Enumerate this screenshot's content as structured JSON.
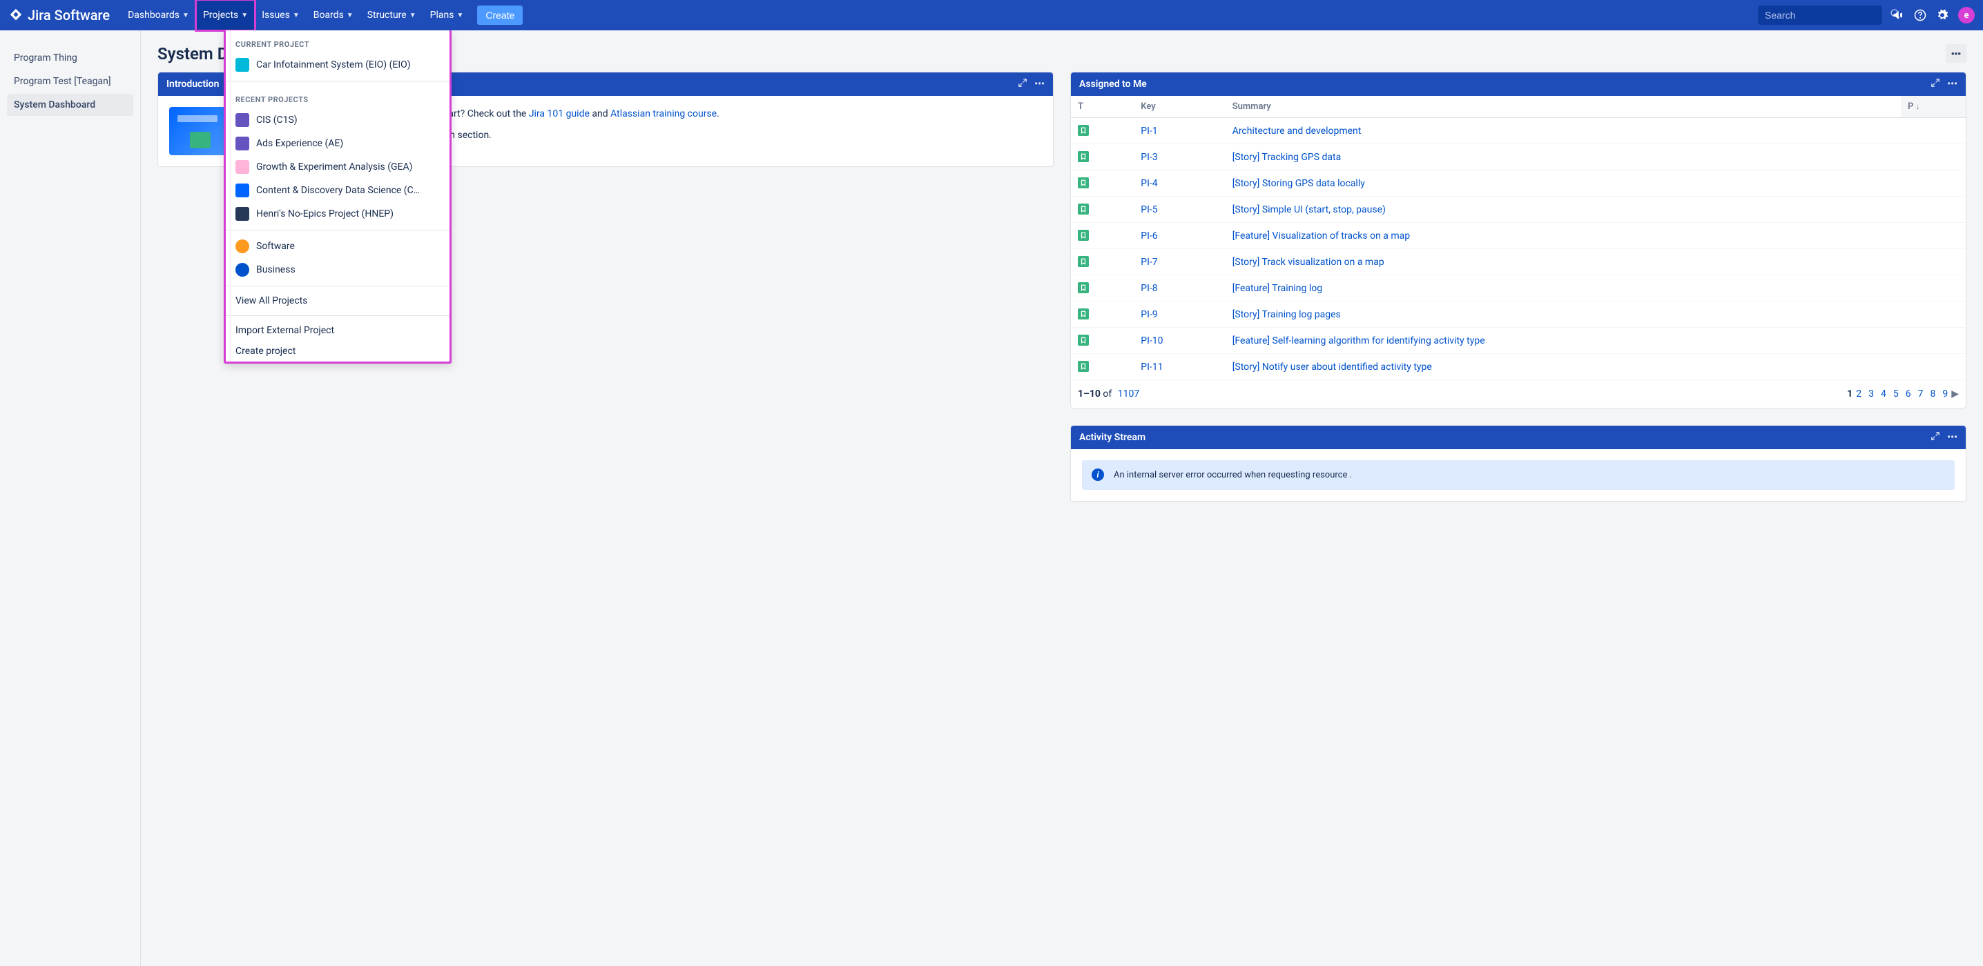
{
  "brand": "Jira Software",
  "nav": {
    "dashboards": "Dashboards",
    "projects": "Projects",
    "issues": "Issues",
    "boards": "Boards",
    "structure": "Structure",
    "plans": "Plans",
    "create": "Create"
  },
  "search_placeholder": "Search",
  "avatar_letter": "e",
  "sidebar": {
    "items": [
      "Program Thing",
      "Program Test [Teagan]",
      "System Dashboard"
    ]
  },
  "page_title": "System Dashboard",
  "intro": {
    "title": "Introduction",
    "text_before": "Welcome to WeWork JIRA. Not sure where to start? Check out the ",
    "link1": "Jira 101 guide",
    "text_mid": " and ",
    "link2": "Atlassian training course",
    "text_after": ".",
    "text2": "You can customize this text in the Administration section."
  },
  "assigned": {
    "title": "Assigned to Me",
    "cols": {
      "t": "T",
      "key": "Key",
      "summary": "Summary",
      "p": "P"
    },
    "rows": [
      {
        "key": "PI-1",
        "summary": "Architecture and development"
      },
      {
        "key": "PI-3",
        "summary": "[Story] Tracking GPS data"
      },
      {
        "key": "PI-4",
        "summary": "[Story] Storing GPS data locally"
      },
      {
        "key": "PI-5",
        "summary": "[Story] Simple UI (start, stop, pause)"
      },
      {
        "key": "PI-6",
        "summary": "[Feature] Visualization of tracks on a map"
      },
      {
        "key": "PI-7",
        "summary": "[Story] Track visualization on a map"
      },
      {
        "key": "PI-8",
        "summary": "[Feature] Training log"
      },
      {
        "key": "PI-9",
        "summary": "[Story] Training log pages"
      },
      {
        "key": "PI-10",
        "summary": "[Feature] Self-learning algorithm for identifying activity type"
      },
      {
        "key": "PI-11",
        "summary": "[Story] Notify user about identified activity type"
      }
    ],
    "footer": {
      "range": "1–10",
      "of": " of ",
      "total": "1107",
      "pages": [
        "1",
        "2",
        "3",
        "4",
        "5",
        "6",
        "7",
        "8",
        "9"
      ]
    }
  },
  "activity": {
    "title": "Activity Stream",
    "error": "An internal server error occurred when requesting resource ."
  },
  "dropdown": {
    "current_title": "CURRENT PROJECT",
    "current": [
      {
        "label": "Car Infotainment System (EIO) (EIO)",
        "color": "teal"
      }
    ],
    "recent_title": "RECENT PROJECTS",
    "recent": [
      {
        "label": "CIS (C1S)",
        "color": "purple"
      },
      {
        "label": "Ads Experience (AE)",
        "color": "purple"
      },
      {
        "label": "Growth & Experiment Analysis (GEA)",
        "color": "pink"
      },
      {
        "label": "Content & Discovery Data Science (C…",
        "color": "blue"
      },
      {
        "label": "Henri's No-Epics Project (HNEP)",
        "color": "dark"
      }
    ],
    "types": [
      {
        "label": "Software",
        "color": "orange"
      },
      {
        "label": "Business",
        "color": "navy"
      }
    ],
    "actions": [
      "View All Projects",
      "Import External Project",
      "Create project"
    ]
  }
}
